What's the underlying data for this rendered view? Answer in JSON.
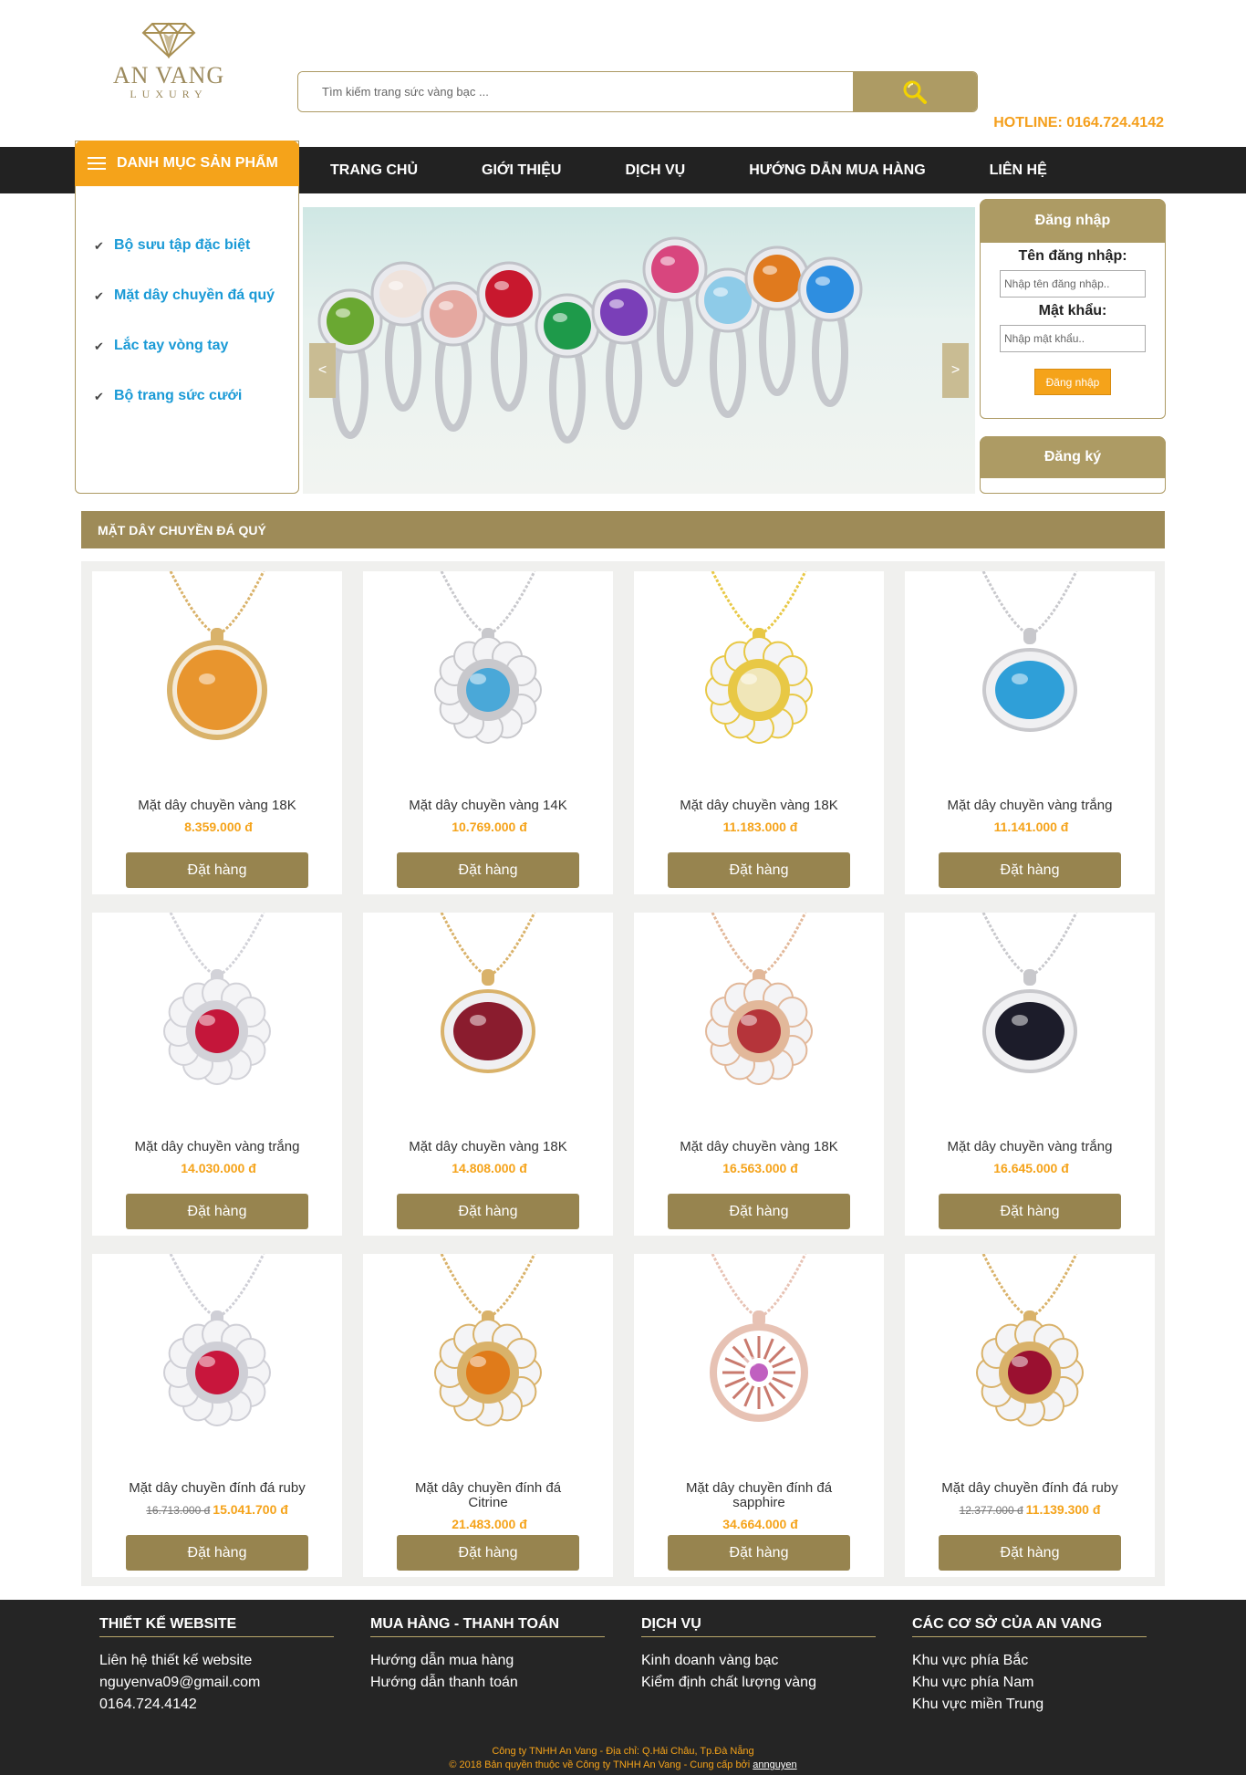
{
  "brand": {
    "name": "AN VANG",
    "tagline": "LUXURY"
  },
  "search": {
    "placeholder": "Tìm kiếm trang sức vàng bạc ..."
  },
  "hotline": "HOTLINE: 0164.724.4142",
  "nav": [
    "TRANG CHỦ",
    "GIỚI THIỆU",
    "DỊCH VỤ",
    "HƯỚNG DẪN MUA HÀNG",
    "LIÊN HỆ"
  ],
  "category": {
    "title": "DANH MỤC SẢN PHẨM",
    "items": [
      "Bộ sưu tập đặc biệt",
      "Mặt dây chuyền đá quý",
      "Lắc tay vòng tay",
      "Bộ trang sức cưới"
    ]
  },
  "slider": {
    "prev": "<",
    "next": ">"
  },
  "login": {
    "title": "Đăng nhập",
    "username_label": "Tên đăng nhập:",
    "username_placeholder": "Nhập tên đăng nhập..",
    "password_label": "Mật khẩu:",
    "password_placeholder": "Nhập mật khẩu..",
    "button": "Đăng nhập",
    "register": "Đăng ký"
  },
  "section_title": "MẶT DÂY CHUYỀN ĐÁ QUÝ",
  "order_label": "Đặt hàng",
  "products": [
    {
      "name": "Mặt dây chuyền vàng 18K",
      "price": "8.359.000 đ",
      "old": "",
      "gem": "#e8952e",
      "metal": "#d9b26a",
      "shape": "round"
    },
    {
      "name": "Mặt dây chuyền vàng 14K",
      "price": "10.769.000 đ",
      "old": "",
      "gem": "#4aa8d8",
      "metal": "#c8c8cc",
      "shape": "flower"
    },
    {
      "name": "Mặt dây chuyền vàng 18K",
      "price": "11.183.000 đ",
      "old": "",
      "gem": "#f0e6b8",
      "metal": "#e8c845",
      "shape": "flower"
    },
    {
      "name": "Mặt dây chuyền vàng trắng",
      "price": "11.141.000 đ",
      "old": "",
      "gem": "#2f9fd8",
      "metal": "#c8c8cc",
      "shape": "oval"
    },
    {
      "name": "Mặt dây chuyền vàng trắng",
      "price": "14.030.000 đ",
      "old": "",
      "gem": "#c4163a",
      "metal": "#d2d2d8",
      "shape": "flower"
    },
    {
      "name": "Mặt dây chuyền vàng 18K",
      "price": "14.808.000 đ",
      "old": "",
      "gem": "#8a1c2e",
      "metal": "#d9b26a",
      "shape": "oval"
    },
    {
      "name": "Mặt dây chuyền vàng 18K",
      "price": "16.563.000 đ",
      "old": "",
      "gem": "#b5343a",
      "metal": "#e2b89a",
      "shape": "flower"
    },
    {
      "name": "Mặt dây chuyền vàng trắng",
      "price": "16.645.000 đ",
      "old": "",
      "gem": "#1c1c2a",
      "metal": "#c8c8cc",
      "shape": "oval"
    },
    {
      "name": "Mặt dây chuyền đính đá ruby",
      "price": "15.041.700 đ",
      "old": "16.713.000 đ",
      "gem": "#c8163c",
      "metal": "#cfcfd6",
      "shape": "flower"
    },
    {
      "name": "Mặt dây chuyền đính đá Citrine",
      "price": "21.483.000 đ",
      "old": "",
      "gem": "#e07b1a",
      "metal": "#d9b26a",
      "shape": "flower"
    },
    {
      "name": "Mặt dây chuyền đính đá sapphire",
      "price": "34.664.000 đ",
      "old": "",
      "gem": "#c060c0",
      "metal": "#e7c2b4",
      "shape": "disc"
    },
    {
      "name": "Mặt dây chuyền đính đá ruby",
      "price": "11.139.300 đ",
      "old": "12.377.000 đ",
      "gem": "#9a1030",
      "metal": "#d9b26a",
      "shape": "flower"
    }
  ],
  "rings": [
    "#6aa832",
    "#efe3dc",
    "#e5a8a0",
    "#c8182e",
    "#1e9a4a",
    "#7a3fb8",
    "#d8467e",
    "#8ecbe8",
    "#e07a1e",
    "#2e8ee0"
  ],
  "footer": {
    "columns": [
      {
        "title": "THIẾT KẾ WEBSITE",
        "items": [
          "Liên hệ thiết kế website",
          "nguyenva09@gmail.com",
          "0164.724.4142"
        ]
      },
      {
        "title": "MUA HÀNG - THANH TOÁN",
        "items": [
          "Hướng dẫn mua hàng",
          "Hướng dẫn thanh toán"
        ]
      },
      {
        "title": "DỊCH VỤ",
        "items": [
          "Kinh doanh vàng bạc",
          "Kiểm định chất lượng vàng"
        ]
      },
      {
        "title": "CÁC CƠ SỞ CỦA AN VANG",
        "items": [
          "Khu vực phía Bắc",
          "Khu vực phía Nam",
          "Khu vực miền Trung"
        ]
      }
    ],
    "address": "Công ty TNHH An Vang - Địa chỉ: Q.Hải Châu, Tp.Đà Nẵng",
    "copyright": "© 2018 Bản quyền thuộc về Công ty TNHH An Vang - Cung cấp bởi",
    "author": "annguyen"
  },
  "colors": {
    "gold": "#ad9b64",
    "orange": "#f5a31a",
    "dark": "#222222",
    "link": "#1a9ad6"
  }
}
